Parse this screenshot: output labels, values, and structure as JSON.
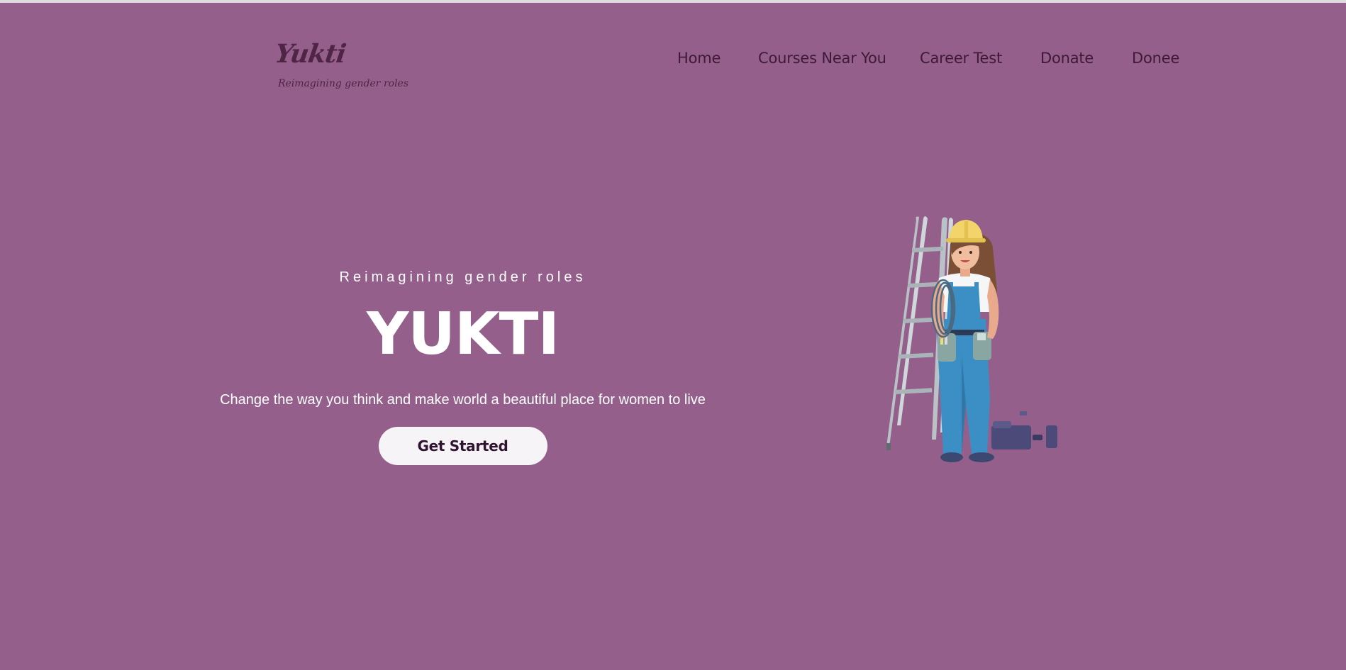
{
  "brand": {
    "name": "Yukti",
    "tagline": "Reimagining gender roles"
  },
  "nav": {
    "items": [
      "Home",
      "Courses Near You",
      "Career Test",
      "Donate",
      "Donee"
    ]
  },
  "hero": {
    "kicker": "Reimagining gender roles",
    "title": "YUKTI",
    "description": "Change the way you think and make world a beautiful place for women to live",
    "cta_label": "Get Started"
  },
  "colors": {
    "background": "#94608b",
    "nav_text": "#3e1a36",
    "brand_text": "#4f2545",
    "cta_background": "#f6f4f7",
    "cta_text": "#2f1330"
  },
  "illustration": {
    "icon": "woman-construction-worker-with-ladder"
  }
}
